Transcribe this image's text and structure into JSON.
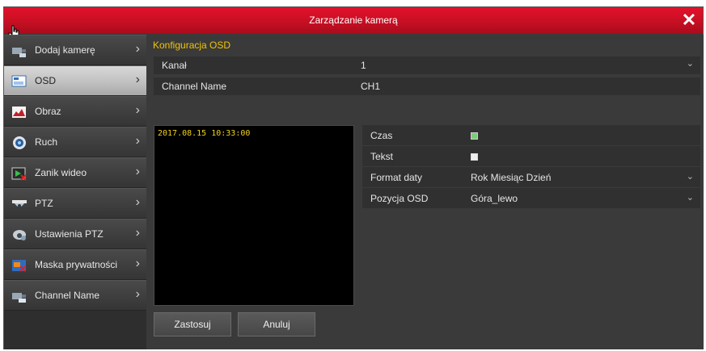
{
  "window": {
    "title": "Zarządzanie kamerą",
    "close_icon": "close-icon"
  },
  "colors": {
    "title_bar": "#d0102a",
    "accent_text": "#f2c400",
    "timestamp": "#f2d21b"
  },
  "sidebar": {
    "items": [
      {
        "label": "Dodaj kamerę",
        "icon": "add-camera-icon",
        "active": false
      },
      {
        "label": "OSD",
        "icon": "osd-icon",
        "active": true
      },
      {
        "label": "Obraz",
        "icon": "image-icon",
        "active": false
      },
      {
        "label": "Ruch",
        "icon": "motion-icon",
        "active": false
      },
      {
        "label": "Zanik wideo",
        "icon": "video-loss-icon",
        "active": false
      },
      {
        "label": "PTZ",
        "icon": "ptz-icon",
        "active": false
      },
      {
        "label": "Ustawienia PTZ",
        "icon": "ptz-settings-icon",
        "active": false
      },
      {
        "label": "Maska prywatności",
        "icon": "privacy-mask-icon",
        "active": false
      },
      {
        "label": "Channel Name",
        "icon": "channel-name-icon",
        "active": false
      }
    ]
  },
  "main": {
    "section_title": "Konfiguracja OSD",
    "channel": {
      "label": "Kanał",
      "value": "1"
    },
    "channel_name": {
      "label": "Channel Name",
      "value": "CH1"
    },
    "preview": {
      "timestamp": "2017.08.15 10:33:00"
    },
    "options": {
      "time": {
        "label": "Czas",
        "checked": true
      },
      "text": {
        "label": "Tekst",
        "checked": false
      },
      "date_format": {
        "label": "Format daty",
        "value": "Rok Miesiąc Dzień"
      },
      "osd_position": {
        "label": "Pozycja OSD",
        "value": "Góra_lewo"
      }
    },
    "buttons": {
      "apply": "Zastosuj",
      "cancel": "Anuluj"
    }
  }
}
